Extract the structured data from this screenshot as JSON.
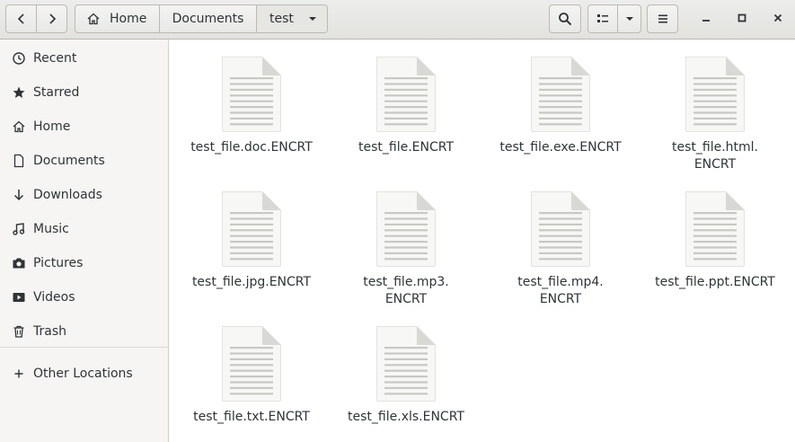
{
  "toolbar": {
    "back_icon": "chevron-left-icon",
    "forward_icon": "chevron-right-icon",
    "search_icon": "search-icon",
    "view_list_icon": "list-view-icon",
    "view_options_icon": "chevron-down-icon",
    "menu_icon": "hamburger-menu-icon"
  },
  "pathbar": {
    "crumbs": [
      "Home",
      "Documents",
      "test"
    ]
  },
  "window": {
    "minimize": "minimize-icon",
    "maximize": "maximize-icon",
    "close": "close-icon"
  },
  "sidebar": {
    "items": [
      {
        "label": "Recent",
        "icon": "clock-icon"
      },
      {
        "label": "Starred",
        "icon": "star-icon"
      },
      {
        "label": "Home",
        "icon": "home-icon"
      },
      {
        "label": "Documents",
        "icon": "document-icon"
      },
      {
        "label": "Downloads",
        "icon": "download-icon"
      },
      {
        "label": "Music",
        "icon": "music-icon"
      },
      {
        "label": "Pictures",
        "icon": "camera-icon"
      },
      {
        "label": "Videos",
        "icon": "video-icon"
      },
      {
        "label": "Trash",
        "icon": "trash-icon"
      }
    ],
    "other_locations": {
      "label": "Other Locations",
      "icon": "plus-icon"
    }
  },
  "files": [
    {
      "name": "test_file.doc.ENCRT"
    },
    {
      "name": "test_file.ENCRT"
    },
    {
      "name": "test_file.exe.ENCRT"
    },
    {
      "name": "test_file.html.\nENCRT"
    },
    {
      "name": "test_file.jpg.ENCRT"
    },
    {
      "name": "test_file.mp3.\nENCRT"
    },
    {
      "name": "test_file.mp4.\nENCRT"
    },
    {
      "name": "test_file.ppt.ENCRT"
    },
    {
      "name": "test_file.txt.ENCRT"
    },
    {
      "name": "test_file.xls.ENCRT"
    }
  ],
  "colors": {
    "sidebar_bg": "#f6f5f4",
    "header_bg": "#e8e8e6",
    "doc_icon_fill": "#f7f7f5",
    "doc_icon_lines": "#c8c8c4"
  }
}
